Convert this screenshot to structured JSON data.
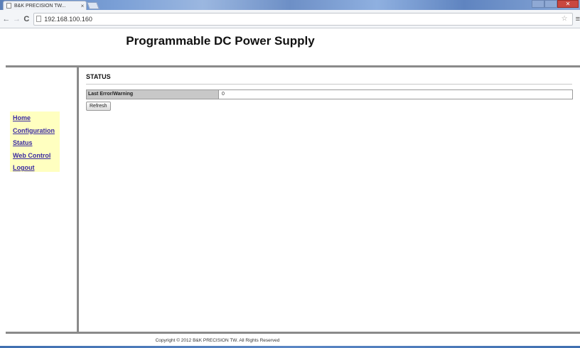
{
  "browser": {
    "tab_title": "B&K PRECISION TW...",
    "tab_close": "×",
    "url": "192.168.100.160",
    "close_glyph": "✕"
  },
  "icons": {
    "back": "←",
    "forward": "→",
    "reload": "C",
    "star": "☆",
    "menu": "≡"
  },
  "page": {
    "title": "Programmable DC Power Supply"
  },
  "nav": {
    "items": [
      {
        "label": "Home"
      },
      {
        "label": "Configuration"
      },
      {
        "label": "Status"
      },
      {
        "label": "Web Control"
      },
      {
        "label": "Logout"
      }
    ]
  },
  "status": {
    "heading": "STATUS",
    "rows": [
      {
        "label": "Last Error/Warning",
        "value": "0"
      }
    ],
    "refresh_label": "Refresh"
  },
  "footer": {
    "copyright": "Copyright © 2012 B&K PRECISION TW. All Rights Reserved"
  },
  "colors": {
    "nav_bg": "#ffffc0",
    "nav_link": "#3a2aa0",
    "label_cell_bg": "#c8c8c8"
  }
}
